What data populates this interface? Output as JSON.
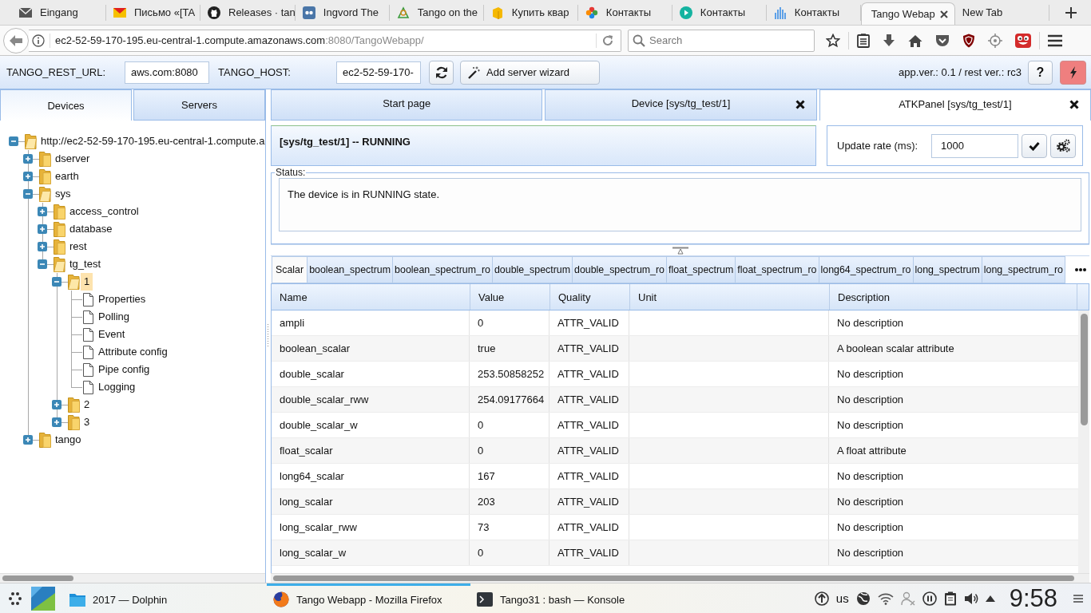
{
  "browser": {
    "tabs": [
      {
        "title": "Eingang",
        "selected": false
      },
      {
        "title": "Письмо «[TA",
        "selected": false
      },
      {
        "title": "Releases · tan",
        "selected": false
      },
      {
        "title": "Ingvord The",
        "selected": false
      },
      {
        "title": "Tango on the",
        "selected": false
      },
      {
        "title": "Купить квар",
        "selected": false
      },
      {
        "title": "Контакты",
        "selected": false
      },
      {
        "title": "Контакты",
        "selected": false
      },
      {
        "title": "Контакты",
        "selected": false
      },
      {
        "title": "Tango Webap",
        "selected": true
      },
      {
        "title": "New Tab",
        "selected": false
      }
    ],
    "address": {
      "host": "ec2-52-59-170-195.eu-central-1.compute.amazonaws.com",
      "path": ":8080/TangoWebapp/"
    },
    "search": {
      "placeholder": "Search"
    }
  },
  "app_toolbar": {
    "rest_url": {
      "label": "TANGO_REST_URL:",
      "value": "aws.com:8080"
    },
    "host": {
      "label": "TANGO_HOST:",
      "value": "ec2-52-59-170-"
    },
    "wizard_button": "Add server wizard",
    "version": "app.ver.: 0.1 / rest ver.: rc3",
    "help_button": "?"
  },
  "sidebar": {
    "tabs": [
      {
        "label": "Devices",
        "selected": true
      },
      {
        "label": "Servers",
        "selected": false
      }
    ],
    "tree": [
      {
        "label": "http://ec2-52-59-170-195.eu-central-1.compute.a",
        "kind": "folder",
        "expanded": true,
        "selected": false,
        "children": [
          {
            "label": "dserver",
            "kind": "folder",
            "expanded": false,
            "selected": false
          },
          {
            "label": "earth",
            "kind": "folder",
            "expanded": false,
            "selected": false
          },
          {
            "label": "sys",
            "kind": "folder",
            "expanded": true,
            "selected": false,
            "children": [
              {
                "label": "access_control",
                "kind": "folder",
                "expanded": false,
                "selected": false
              },
              {
                "label": "database",
                "kind": "folder",
                "expanded": false,
                "selected": false
              },
              {
                "label": "rest",
                "kind": "folder",
                "expanded": false,
                "selected": false
              },
              {
                "label": "tg_test",
                "kind": "folder",
                "expanded": true,
                "selected": false,
                "children": [
                  {
                    "label": "1",
                    "kind": "folder",
                    "expanded": true,
                    "selected": true,
                    "children": [
                      {
                        "label": "Properties",
                        "kind": "file",
                        "selected": false
                      },
                      {
                        "label": "Polling",
                        "kind": "file",
                        "selected": false
                      },
                      {
                        "label": "Event",
                        "kind": "file",
                        "selected": false
                      },
                      {
                        "label": "Attribute config",
                        "kind": "file",
                        "selected": false
                      },
                      {
                        "label": "Pipe config",
                        "kind": "file",
                        "selected": false
                      },
                      {
                        "label": "Logging",
                        "kind": "file",
                        "selected": false
                      }
                    ]
                  },
                  {
                    "label": "2",
                    "kind": "folder",
                    "expanded": false,
                    "selected": false
                  },
                  {
                    "label": "3",
                    "kind": "folder",
                    "expanded": false,
                    "selected": false
                  }
                ]
              }
            ]
          },
          {
            "label": "tango",
            "kind": "folder",
            "expanded": false,
            "selected": false
          }
        ]
      }
    ]
  },
  "main": {
    "device_tabs": [
      {
        "label": "Start page",
        "selected": false,
        "closable": false
      },
      {
        "label": "Device [sys/tg_test/1]",
        "selected": false,
        "closable": true
      },
      {
        "label": "ATKPanel [sys/tg_test/1]",
        "selected": true,
        "closable": true
      }
    ],
    "device_header": {
      "title": "[sys/tg_test/1] -- RUNNING"
    },
    "update_rate": {
      "label": "Update rate (ms):",
      "value": "1000"
    },
    "status": {
      "legend": "Status:",
      "text": "The device is in RUNNING state."
    },
    "attribute_tabs": [
      {
        "label": "Scalar",
        "selected": true
      },
      {
        "label": "boolean_spectrum",
        "selected": false
      },
      {
        "label": "boolean_spectrum_ro",
        "selected": false
      },
      {
        "label": "double_spectrum",
        "selected": false
      },
      {
        "label": "double_spectrum_ro",
        "selected": false
      },
      {
        "label": "float_spectrum",
        "selected": false
      },
      {
        "label": "float_spectrum_ro",
        "selected": false
      },
      {
        "label": "long64_spectrum_ro",
        "selected": false
      },
      {
        "label": "long_spectrum",
        "selected": false
      },
      {
        "label": "long_spectrum_ro",
        "selected": false
      }
    ],
    "table": {
      "columns": [
        "Name",
        "Value",
        "Quality",
        "Unit",
        "Description"
      ],
      "rows": [
        {
          "name": "ampli",
          "value": "0",
          "quality": "ATTR_VALID",
          "description": "No description"
        },
        {
          "name": "boolean_scalar",
          "value": "true",
          "quality": "ATTR_VALID",
          "description": "A boolean scalar attribute"
        },
        {
          "name": "double_scalar",
          "value": "253.50858252",
          "quality": "ATTR_VALID",
          "description": "No description"
        },
        {
          "name": "double_scalar_rww",
          "value": "254.09177664",
          "quality": "ATTR_VALID",
          "description": "No description"
        },
        {
          "name": "double_scalar_w",
          "value": "0",
          "quality": "ATTR_VALID",
          "description": "No description"
        },
        {
          "name": "float_scalar",
          "value": "0",
          "quality": "ATTR_VALID",
          "description": "A float attribute"
        },
        {
          "name": "long64_scalar",
          "value": "167",
          "quality": "ATTR_VALID",
          "description": "No description"
        },
        {
          "name": "long_scalar",
          "value": "203",
          "quality": "ATTR_VALID",
          "description": "No description"
        },
        {
          "name": "long_scalar_rww",
          "value": "73",
          "quality": "ATTR_VALID",
          "description": "No description"
        },
        {
          "name": "long_scalar_w",
          "value": "0",
          "quality": "ATTR_VALID",
          "description": "No description"
        }
      ]
    }
  },
  "taskbar": {
    "tasks": [
      {
        "title": "2017 — Dolphin",
        "selected": false
      },
      {
        "title": "Tango Webapp - Mozilla Firefox",
        "selected": true
      },
      {
        "title": "Tango31 : bash — Konsole",
        "selected": false
      }
    ],
    "keyboard_layout": "us",
    "clock": "9:58"
  }
}
